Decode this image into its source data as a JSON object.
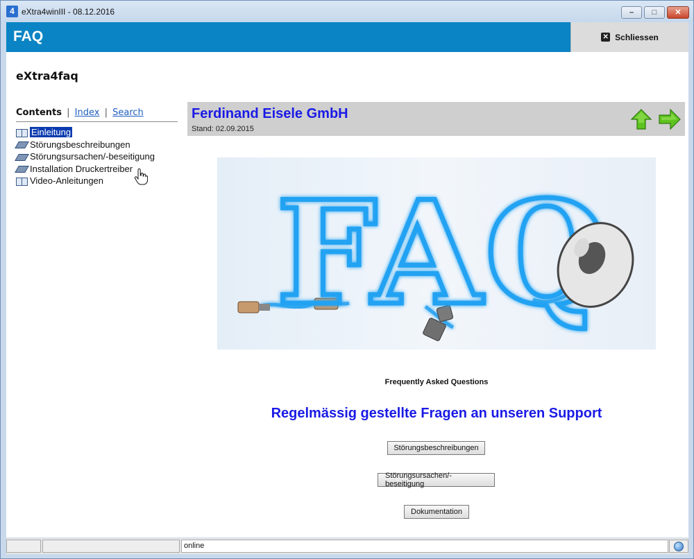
{
  "window": {
    "title": "eXtra4winIII  -  08.12.2016",
    "app_icon_glyph": "4",
    "controls": {
      "minimize": "–",
      "maximize": "□",
      "close": "✕"
    }
  },
  "header": {
    "title": "FAQ",
    "close_label": "Schliessen"
  },
  "app_name": "eXtra4faq",
  "nav": {
    "tabs": {
      "contents": "Contents",
      "index": "Index",
      "search": "Search",
      "separator": "|"
    },
    "items": [
      {
        "label": "Einleitung",
        "icon": "open-book-icon",
        "selected": true
      },
      {
        "label": "Störungsbeschreibungen",
        "icon": "closed-book-icon",
        "selected": false
      },
      {
        "label": "Störungsursachen/-beseitigung",
        "icon": "closed-book-icon",
        "selected": false
      },
      {
        "label": "Installation Druckertreiber",
        "icon": "closed-book-icon",
        "selected": false
      },
      {
        "label": "Video-Anleitungen",
        "icon": "open-book-icon",
        "selected": false
      }
    ]
  },
  "banner": {
    "company": "Ferdinand Eisele GmbH",
    "stand": "Stand: 02.09.2015",
    "nav_up_icon": "arrow-up-icon",
    "nav_next_icon": "arrow-right-icon"
  },
  "main": {
    "image_text": "FAQ",
    "caption": "Frequently Asked Questions",
    "headline": "Regelmässig gestellte Fragen an unseren Support",
    "buttons": {
      "b1": "Störungsbeschreibungen",
      "b2": "Störungsursachen/-beseitigung",
      "b3": "Dokumentation"
    }
  },
  "statusbar": {
    "cell1": "",
    "cell2": "",
    "status": "online",
    "globe_icon": "globe-icon"
  },
  "colors": {
    "header_blue": "#0a84c4",
    "link_blue": "#1f5fbf",
    "heading_blue": "#1a1ae6",
    "arrow_green": "#5ec21f"
  }
}
